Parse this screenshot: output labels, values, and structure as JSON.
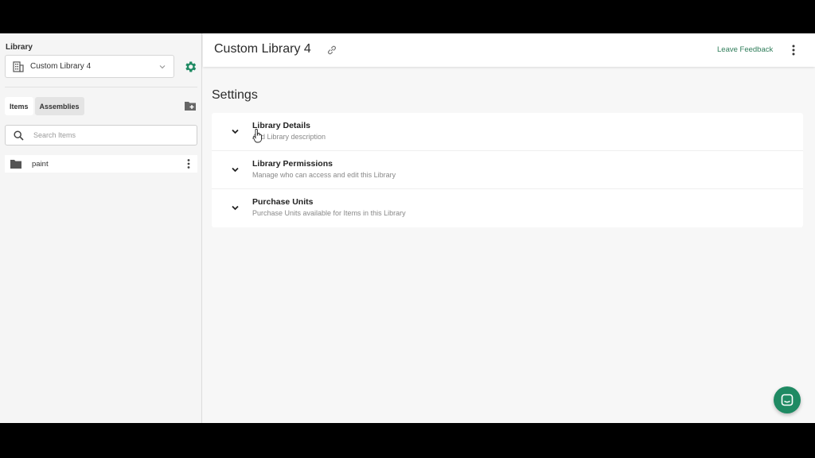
{
  "colors": {
    "accent": "#1f8a63",
    "link": "#2f7d5a"
  },
  "sidebar": {
    "heading": "Library",
    "library_select": {
      "value": "Custom Library 4",
      "icon": "building-icon"
    },
    "settings_icon": "gear-icon",
    "tabs": [
      {
        "label": "Items",
        "active": true
      },
      {
        "label": "Assemblies",
        "active": false
      }
    ],
    "new_folder_icon": "folder-add-icon",
    "search": {
      "placeholder": "Search Items",
      "value": ""
    },
    "items": [
      {
        "label": "paint",
        "icon": "folder-icon"
      }
    ]
  },
  "header": {
    "title": "Custom Library 4",
    "link_icon": "link-icon",
    "feedback_label": "Leave Feedback",
    "more_icon": "more-vertical-icon"
  },
  "main": {
    "heading": "Settings",
    "sections": [
      {
        "title": "Library Details",
        "description": "Add Library description"
      },
      {
        "title": "Library Permissions",
        "description": "Manage who can access and edit this Library"
      },
      {
        "title": "Purchase Units",
        "description": "Purchase Units available for Items in this Library"
      }
    ]
  },
  "chat_button_icon": "chat-icon"
}
